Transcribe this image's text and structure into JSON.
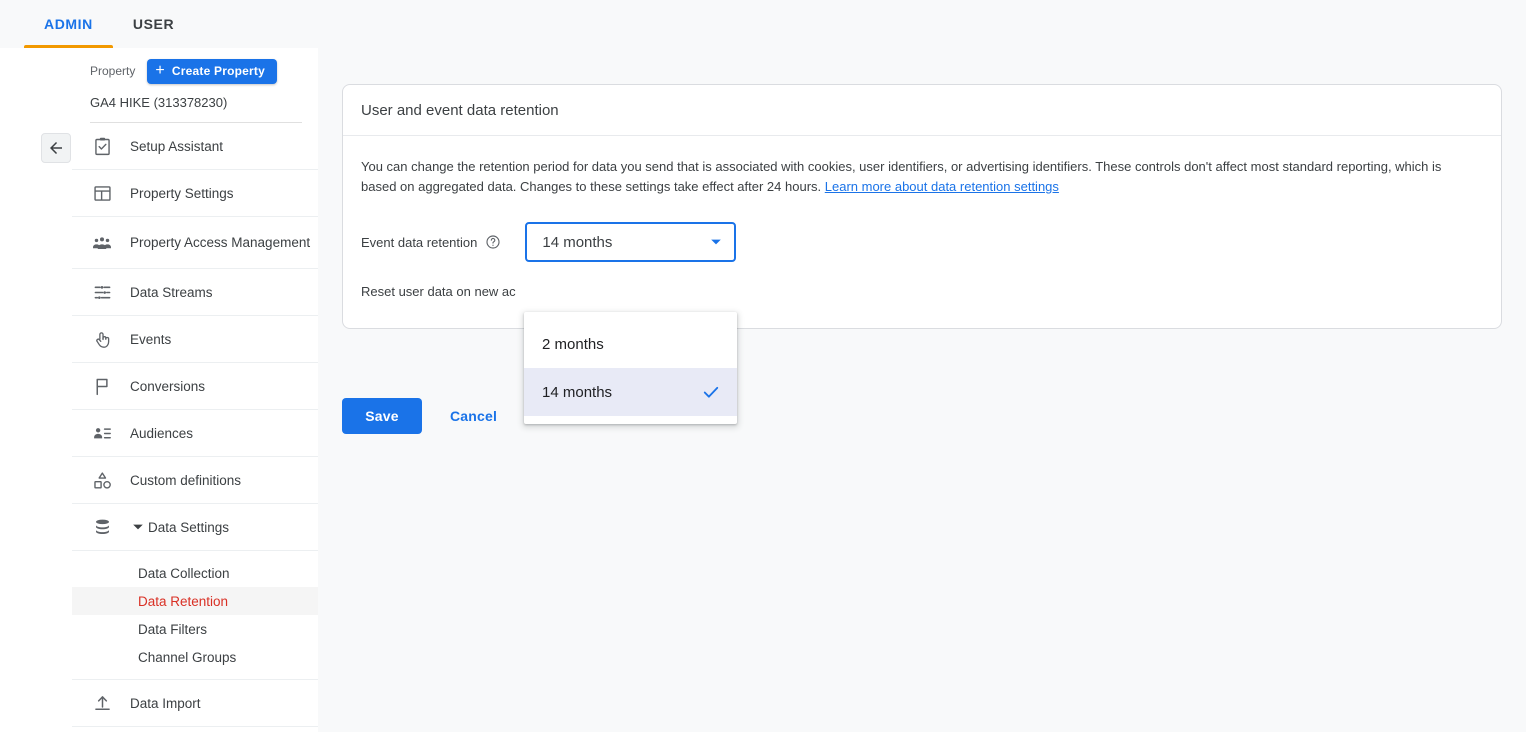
{
  "tabs": [
    {
      "label": "ADMIN",
      "active": true
    },
    {
      "label": "USER",
      "active": false
    }
  ],
  "sidebar": {
    "property_label": "Property",
    "create_button": "Create Property",
    "property_name": "GA4 HIKE (313378230)",
    "items": [
      {
        "label": "Setup Assistant",
        "icon": "clipboard-check-icon"
      },
      {
        "label": "Property Settings",
        "icon": "layout-icon"
      },
      {
        "label": "Property Access Management",
        "icon": "people-group-icon"
      },
      {
        "label": "Data Streams",
        "icon": "tune-icon"
      },
      {
        "label": "Events",
        "icon": "touch-icon"
      },
      {
        "label": "Conversions",
        "icon": "flag-icon"
      },
      {
        "label": "Audiences",
        "icon": "person-list-icon"
      },
      {
        "label": "Custom definitions",
        "icon": "shapes-icon"
      }
    ],
    "group": {
      "label": "Data Settings",
      "icon": "database-icon",
      "expanded": true,
      "children": [
        {
          "label": "Data Collection",
          "active": false
        },
        {
          "label": "Data Retention",
          "active": true
        },
        {
          "label": "Data Filters",
          "active": false
        },
        {
          "label": "Channel Groups",
          "active": false
        }
      ]
    },
    "items_after": [
      {
        "label": "Data Import",
        "icon": "upload-icon"
      }
    ]
  },
  "main": {
    "card_title": "User and event data retention",
    "description_part1": "You can change the retention period for data you send that is associated with cookies, user identifiers, or advertising identifiers. These controls don't affect most standard reporting, which is based on aggregated data. Changes to these settings take effect after 24 hours. ",
    "description_link": "Learn more about data retention settings",
    "field_label": "Event data retention",
    "select_value": "14 months",
    "reset_label": "Reset user data on new ac",
    "save_label": "Save",
    "cancel_label": "Cancel"
  },
  "dropdown": {
    "open": true,
    "options": [
      {
        "label": "2 months",
        "selected": false
      },
      {
        "label": "14 months",
        "selected": true
      }
    ]
  },
  "colors": {
    "accent_blue": "#1a73e8",
    "tab_underline_orange": "#f29900",
    "active_subnav_red": "#d93025",
    "selected_option_bg": "#e8eaf6"
  }
}
